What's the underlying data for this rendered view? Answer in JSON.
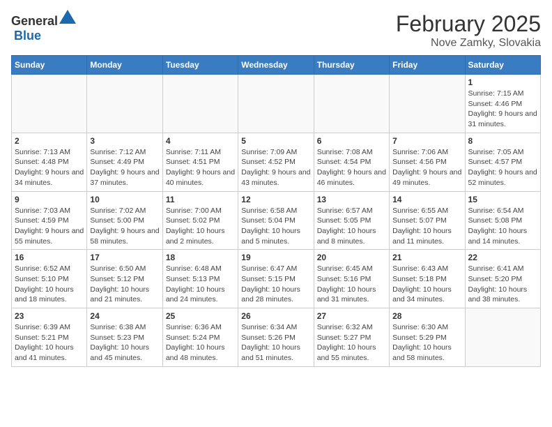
{
  "header": {
    "logo_general": "General",
    "logo_blue": "Blue",
    "month_title": "February 2025",
    "subtitle": "Nove Zamky, Slovakia"
  },
  "days_of_week": [
    "Sunday",
    "Monday",
    "Tuesday",
    "Wednesday",
    "Thursday",
    "Friday",
    "Saturday"
  ],
  "weeks": [
    [
      {
        "day": "",
        "info": ""
      },
      {
        "day": "",
        "info": ""
      },
      {
        "day": "",
        "info": ""
      },
      {
        "day": "",
        "info": ""
      },
      {
        "day": "",
        "info": ""
      },
      {
        "day": "",
        "info": ""
      },
      {
        "day": "1",
        "info": "Sunrise: 7:15 AM\nSunset: 4:46 PM\nDaylight: 9 hours and 31 minutes."
      }
    ],
    [
      {
        "day": "2",
        "info": "Sunrise: 7:13 AM\nSunset: 4:48 PM\nDaylight: 9 hours and 34 minutes."
      },
      {
        "day": "3",
        "info": "Sunrise: 7:12 AM\nSunset: 4:49 PM\nDaylight: 9 hours and 37 minutes."
      },
      {
        "day": "4",
        "info": "Sunrise: 7:11 AM\nSunset: 4:51 PM\nDaylight: 9 hours and 40 minutes."
      },
      {
        "day": "5",
        "info": "Sunrise: 7:09 AM\nSunset: 4:52 PM\nDaylight: 9 hours and 43 minutes."
      },
      {
        "day": "6",
        "info": "Sunrise: 7:08 AM\nSunset: 4:54 PM\nDaylight: 9 hours and 46 minutes."
      },
      {
        "day": "7",
        "info": "Sunrise: 7:06 AM\nSunset: 4:56 PM\nDaylight: 9 hours and 49 minutes."
      },
      {
        "day": "8",
        "info": "Sunrise: 7:05 AM\nSunset: 4:57 PM\nDaylight: 9 hours and 52 minutes."
      }
    ],
    [
      {
        "day": "9",
        "info": "Sunrise: 7:03 AM\nSunset: 4:59 PM\nDaylight: 9 hours and 55 minutes."
      },
      {
        "day": "10",
        "info": "Sunrise: 7:02 AM\nSunset: 5:00 PM\nDaylight: 9 hours and 58 minutes."
      },
      {
        "day": "11",
        "info": "Sunrise: 7:00 AM\nSunset: 5:02 PM\nDaylight: 10 hours and 2 minutes."
      },
      {
        "day": "12",
        "info": "Sunrise: 6:58 AM\nSunset: 5:04 PM\nDaylight: 10 hours and 5 minutes."
      },
      {
        "day": "13",
        "info": "Sunrise: 6:57 AM\nSunset: 5:05 PM\nDaylight: 10 hours and 8 minutes."
      },
      {
        "day": "14",
        "info": "Sunrise: 6:55 AM\nSunset: 5:07 PM\nDaylight: 10 hours and 11 minutes."
      },
      {
        "day": "15",
        "info": "Sunrise: 6:54 AM\nSunset: 5:08 PM\nDaylight: 10 hours and 14 minutes."
      }
    ],
    [
      {
        "day": "16",
        "info": "Sunrise: 6:52 AM\nSunset: 5:10 PM\nDaylight: 10 hours and 18 minutes."
      },
      {
        "day": "17",
        "info": "Sunrise: 6:50 AM\nSunset: 5:12 PM\nDaylight: 10 hours and 21 minutes."
      },
      {
        "day": "18",
        "info": "Sunrise: 6:48 AM\nSunset: 5:13 PM\nDaylight: 10 hours and 24 minutes."
      },
      {
        "day": "19",
        "info": "Sunrise: 6:47 AM\nSunset: 5:15 PM\nDaylight: 10 hours and 28 minutes."
      },
      {
        "day": "20",
        "info": "Sunrise: 6:45 AM\nSunset: 5:16 PM\nDaylight: 10 hours and 31 minutes."
      },
      {
        "day": "21",
        "info": "Sunrise: 6:43 AM\nSunset: 5:18 PM\nDaylight: 10 hours and 34 minutes."
      },
      {
        "day": "22",
        "info": "Sunrise: 6:41 AM\nSunset: 5:20 PM\nDaylight: 10 hours and 38 minutes."
      }
    ],
    [
      {
        "day": "23",
        "info": "Sunrise: 6:39 AM\nSunset: 5:21 PM\nDaylight: 10 hours and 41 minutes."
      },
      {
        "day": "24",
        "info": "Sunrise: 6:38 AM\nSunset: 5:23 PM\nDaylight: 10 hours and 45 minutes."
      },
      {
        "day": "25",
        "info": "Sunrise: 6:36 AM\nSunset: 5:24 PM\nDaylight: 10 hours and 48 minutes."
      },
      {
        "day": "26",
        "info": "Sunrise: 6:34 AM\nSunset: 5:26 PM\nDaylight: 10 hours and 51 minutes."
      },
      {
        "day": "27",
        "info": "Sunrise: 6:32 AM\nSunset: 5:27 PM\nDaylight: 10 hours and 55 minutes."
      },
      {
        "day": "28",
        "info": "Sunrise: 6:30 AM\nSunset: 5:29 PM\nDaylight: 10 hours and 58 minutes."
      },
      {
        "day": "",
        "info": ""
      }
    ]
  ]
}
